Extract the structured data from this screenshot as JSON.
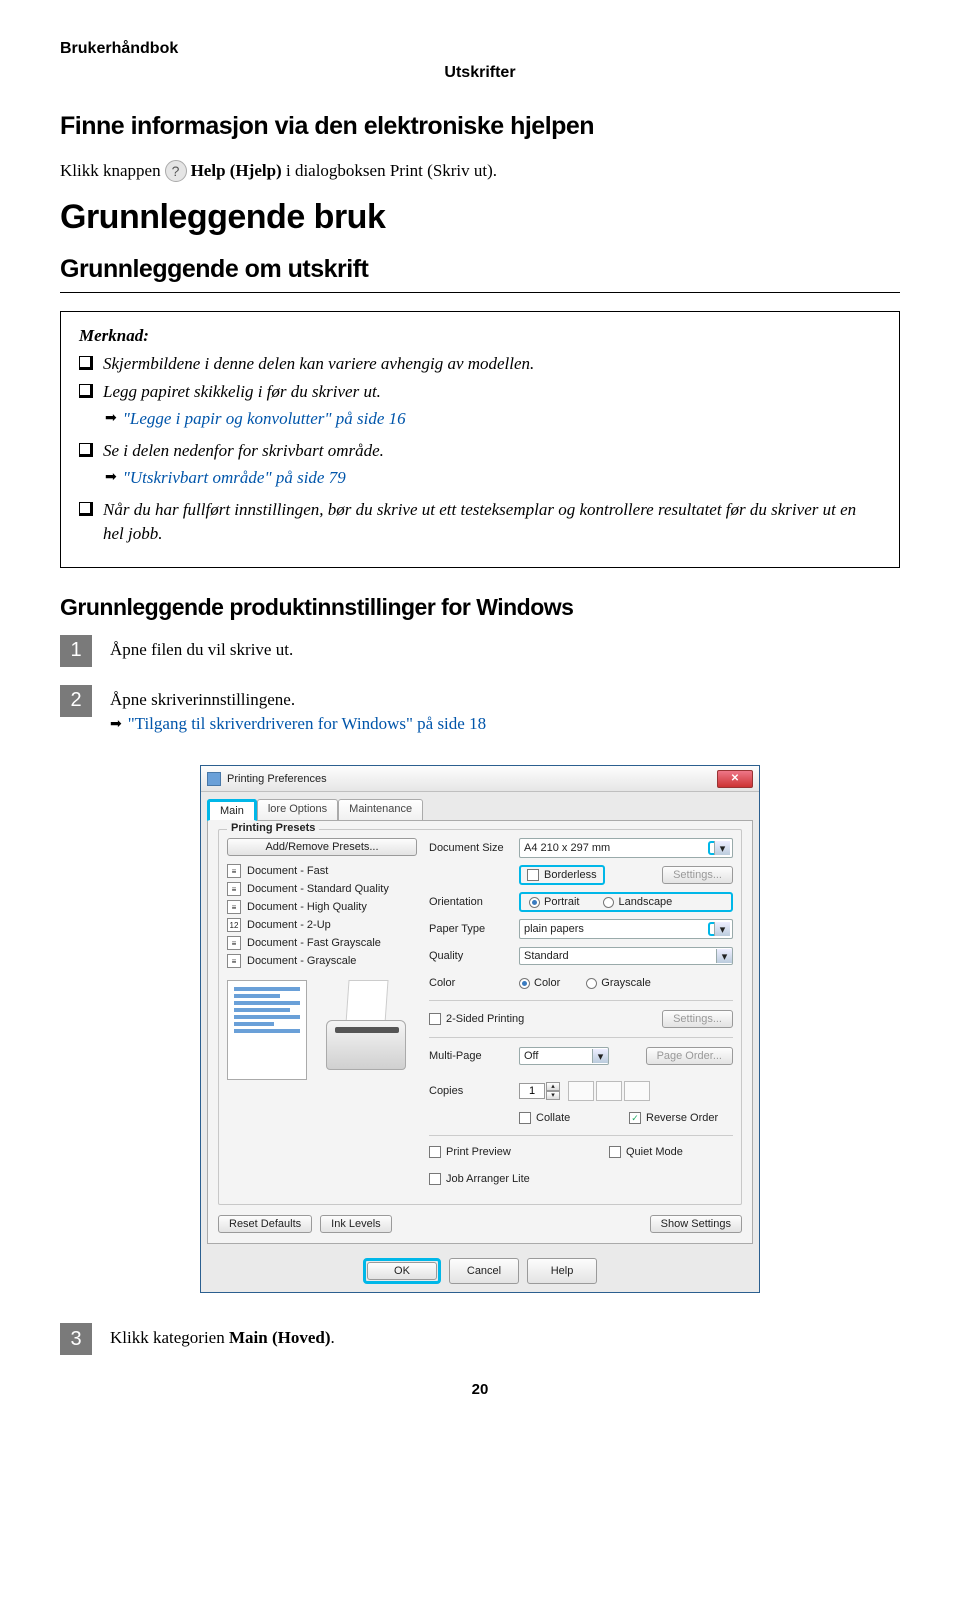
{
  "header": {
    "book": "Brukerhåndbok",
    "section": "Utskrifter"
  },
  "s1": {
    "title": "Finne informasjon via den elektroniske hjelpen",
    "text_pre": "Klikk knappen",
    "help_bold": "Help (Hjelp)",
    "text_post": " i dialogboksen Print (Skriv ut)."
  },
  "s2": {
    "title": "Grunnleggende bruk"
  },
  "s3": {
    "title": "Grunnleggende om utskrift"
  },
  "note": {
    "title": "Merknad:",
    "b1": "Skjermbildene i denne delen kan variere avhengig av modellen.",
    "b2": "Legg papiret skikkelig i før du skriver ut.",
    "link2": "\"Legge i papir og konvolutter\" på side 16",
    "b3": "Se i delen nedenfor for skrivbart område.",
    "link3": "\"Utskrivbart område\" på side 79",
    "b4": "Når du har fullført innstillingen, bør du skrive ut ett testeksemplar og kontrollere resultatet før du skriver ut en hel jobb."
  },
  "s4": {
    "title": "Grunnleggende produktinnstillinger for Windows"
  },
  "steps": {
    "n1": "1",
    "t1": "Åpne filen du vil skrive ut.",
    "n2": "2",
    "t2": "Åpne skriverinnstillingene.",
    "link2": "\"Tilgang til skriverdriveren for Windows\" på side 18",
    "n3": "3",
    "t3_pre": "Klikk kategorien ",
    "t3_bold": "Main (Hoved)",
    "t3_post": "."
  },
  "dialog": {
    "title": "Printing Preferences",
    "tabs": {
      "main": "Main",
      "more": "lore Options",
      "maint": "Maintenance"
    },
    "presets": {
      "group": "Printing Presets",
      "addremove": "Add/Remove Presets...",
      "items": [
        "Document - Fast",
        "Document - Standard Quality",
        "Document - High Quality",
        "Document - 2-Up",
        "Document - Fast Grayscale",
        "Document - Grayscale"
      ]
    },
    "right": {
      "docsize_l": "Document Size",
      "docsize_v": "A4 210 x 297 mm",
      "borderless": "Borderless",
      "settings": "Settings...",
      "orient_l": "Orientation",
      "portrait": "Portrait",
      "landscape": "Landscape",
      "ptype_l": "Paper Type",
      "ptype_v": "plain papers",
      "quality_l": "Quality",
      "quality_v": "Standard",
      "color_l": "Color",
      "color_r": "Color",
      "gray_r": "Grayscale",
      "twosided": "2-Sided Printing",
      "multipage_l": "Multi-Page",
      "multipage_v": "Off",
      "pageorder": "Page Order...",
      "copies_l": "Copies",
      "copies_v": "1",
      "collate": "Collate",
      "reverse": "Reverse Order",
      "preview": "Print Preview",
      "quiet": "Quiet Mode",
      "jobarr": "Job Arranger Lite"
    },
    "bottom": {
      "reset": "Reset Defaults",
      "ink": "Ink Levels",
      "show": "Show Settings"
    },
    "footer": {
      "ok": "OK",
      "cancel": "Cancel",
      "help": "Help"
    }
  },
  "page": "20"
}
